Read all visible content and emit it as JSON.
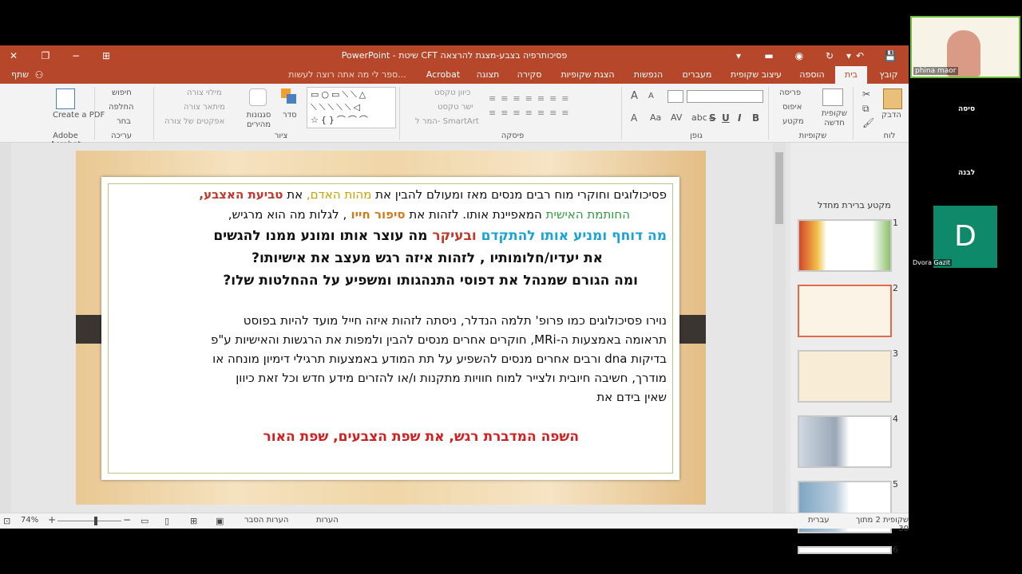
{
  "window": {
    "title": "PowerPoint - שיטת CFT פסיכותרפיה בצבע-מצגת להרצאה"
  },
  "tabs": [
    "קובץ",
    "בית",
    "הוספה",
    "עיצוב שקופית",
    "מעברים",
    "הנפשות",
    "הצגת שקופיות",
    "סקירה",
    "תצוגה",
    "Acrobat"
  ],
  "tell_me": "ספר לי מה אתה רוצה לעשות...",
  "share": "שתף",
  "ribbon": {
    "clipboard": {
      "paste": "הדבק",
      "label": "לוח"
    },
    "slides": {
      "new_slide": "שקופית חדשה",
      "layout": "פריסה",
      "reset": "איפוס",
      "section": "מקטע",
      "label": "שקופיות"
    },
    "font": {
      "label": "גופן",
      "bold": "B",
      "italic": "I",
      "underline": "U",
      "strike": "S",
      "shadow": "abc",
      "spacing": "AV",
      "grow": "A",
      "shrink": "A",
      "case": "Aa"
    },
    "paragraph": {
      "label": "פיסקה",
      "text_dir": "כיוון טקסט",
      "align_text": "ישר טקסט",
      "smartart": "המר ל- SmartArt"
    },
    "drawing": {
      "label": "ציור",
      "arrange": "סדר",
      "quick_styles": "סגנונות מהירים",
      "fill": "מילוי צורה",
      "outline": "מיתאר צורה",
      "effects": "אפקטים של צורה"
    },
    "editing": {
      "label": "עריכה",
      "find": "חיפוש",
      "replace": "החלפה",
      "select": "בחר"
    },
    "acrobat": {
      "create": "Create a PDF",
      "label": "Adobe Acrobat"
    }
  },
  "slide": {
    "para1": [
      [
        {
          "t": "פסיכולוגים וחוקרי מוח רבים מנסים מאז ומעולם להבין את ",
          "c": "#111"
        },
        {
          "t": "מהות האדם, ",
          "c": "#c9a100"
        },
        {
          "t": "את ",
          "c": "#111"
        },
        {
          "t": "טביעת האצבע,",
          "c": "#c0392b"
        }
      ],
      [
        {
          "t": "החותמת האישית ",
          "c": "#2e9e3e"
        },
        {
          "t": "המאפיינת אותו. לזהות את ",
          "c": "#111"
        },
        {
          "t": "סיפור חייו ",
          "c": "#d07a1e"
        },
        {
          "t": ", לגלות מה הוא מרגיש,",
          "c": "#111"
        }
      ]
    ],
    "para2": [
      [
        {
          "t": "מה דוחף ומניע  אותו להתקדם ",
          "c": "#1aa3d8"
        },
        {
          "t": "ובעיקר ",
          "c": "#c0392b"
        },
        {
          "t": "מה עוצר אותו ומונע ממנו  להגשים",
          "c": "#111"
        }
      ],
      [
        {
          "t": "את יעדיו/חלומותיו ,  לזהות איזה רגש מעצב את אישיותו?",
          "c": "#111"
        }
      ],
      [
        {
          "t": "ומה הגורם שמנהל את דפוסי התנהגותו ומשפיע על ההחלטות שלו?",
          "c": "#111"
        }
      ]
    ],
    "para3": [
      "נוירו פסיכולוגים כמו פרופ' תלמה הנדלר, ניסתה לזהות איזה חייל מועד להיות בפוסט",
      "תראומה באמצעות ה-MRi, חוקרים אחרים מנסים להבין ולמפות את הרגשות והאישיות ע\"פ",
      "בדיקות  dna ורבים אחרים מנסים להשפיע על תת המודע באמצעות תרגילי דימיון מונחה או",
      "מודרך, חשיבה חיובית ולצייר למוח חוויות מתקנות ו/או להזרים מידע חדש וכל זאת כיוון",
      "שאין בידם את"
    ],
    "closing": "השפה המדברת רגש, את שפת הצבעים, שפת האור"
  },
  "thumbs": {
    "section": "מקטע ברירת מחדל",
    "numbers": [
      "1",
      "2",
      "3",
      "4",
      "5",
      "6"
    ],
    "selected": 2
  },
  "status": {
    "slide_of": "שקופית 2 מתוך 30",
    "language": "עברית",
    "notes": "הערות",
    "comments": "הערות הסבר",
    "zoom": "74%"
  },
  "meeting": {
    "presenter": "phina maor",
    "tile1": "סיסה",
    "tile2": "לבנה",
    "tile3_initial": "D",
    "tile3_name": "Dvora Gazit",
    "colors": {
      "d_tile": "#0e8a6b"
    }
  }
}
